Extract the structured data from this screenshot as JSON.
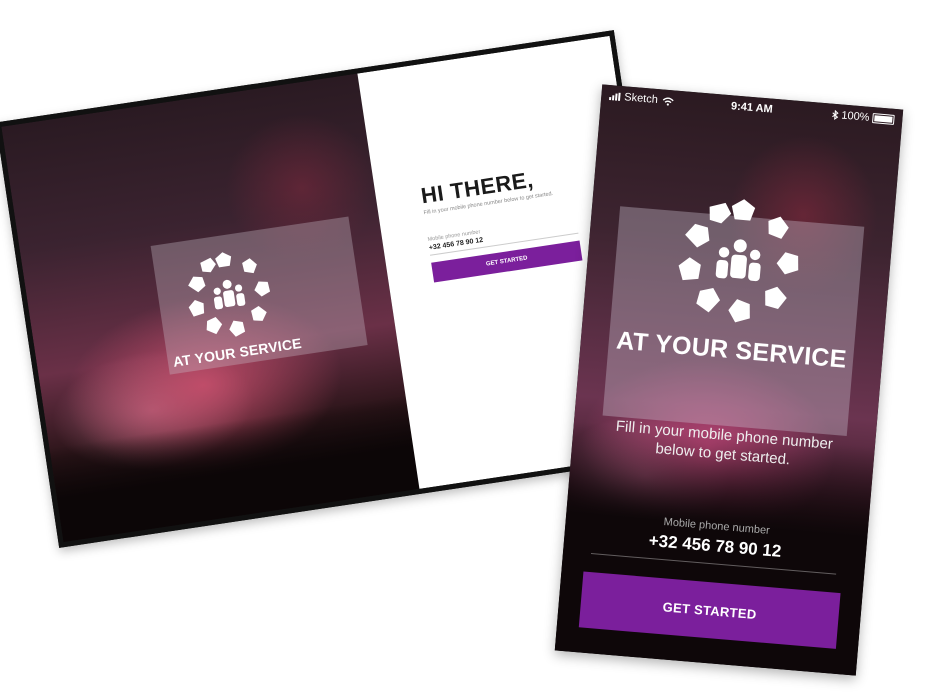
{
  "tablet": {
    "brand": "AT YOUR SERVICE",
    "greeting": "HI THERE,",
    "instruction": "Fill in your mobile phone number below to get started.",
    "phone_label": "Mobile phone number",
    "phone_value": "+32 456 78 90 12",
    "cta_label": "GET STARTED"
  },
  "phone": {
    "status_bar": {
      "carrier": "Sketch",
      "time": "9:41 AM",
      "battery": "100%"
    },
    "brand": "AT YOUR SERVICE",
    "instruction": "Fill in your mobile phone number below to get started.",
    "phone_label": "Mobile phone number",
    "phone_value": "+32 456 78 90 12",
    "cta_label": "GET STARTED"
  },
  "colors": {
    "accent": "#7b1f9c",
    "background_white": "#ffffff",
    "device_frame": "#111111"
  }
}
